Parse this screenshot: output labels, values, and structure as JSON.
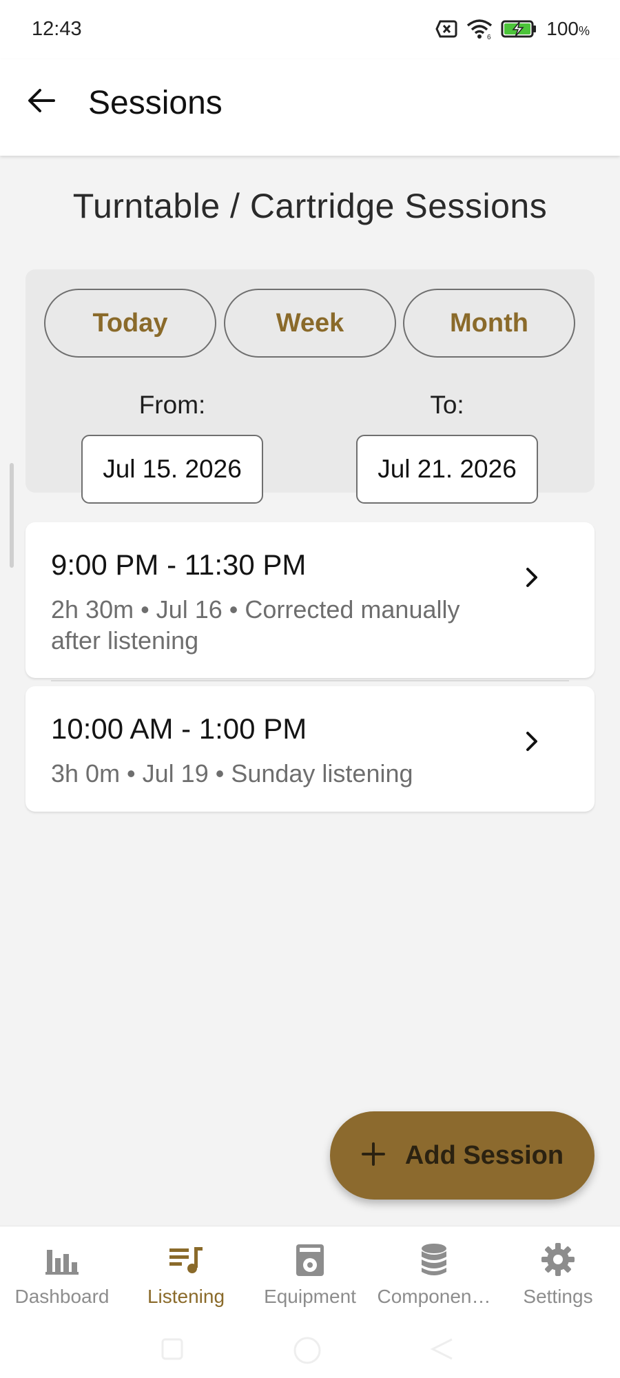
{
  "status_bar": {
    "time": "12:43",
    "battery": "100",
    "battery_unit": "%"
  },
  "app_bar": {
    "title": "Sessions",
    "back_icon": "arrow-back-icon"
  },
  "page": {
    "heading": "Turntable / Cartridge Sessions"
  },
  "filters": {
    "ranges": [
      {
        "label": "Today"
      },
      {
        "label": "Week"
      },
      {
        "label": "Month"
      }
    ],
    "from_label": "From:",
    "to_label": "To:",
    "from_value": "Jul 15. 2026",
    "to_value": "Jul 21. 2026"
  },
  "sessions": [
    {
      "time_range": "9:00 PM - 11:30 PM",
      "details": "2h 30m • Jul 16 • Corrected manually after listening"
    },
    {
      "time_range": "10:00 AM - 1:00 PM",
      "details": "3h 0m • Jul 19 • Sunday listening"
    }
  ],
  "fab": {
    "label": "Add Session",
    "icon": "plus-icon"
  },
  "bottom_nav": {
    "items": [
      {
        "label": "Dashboard",
        "icon": "bar-chart-icon"
      },
      {
        "label": "Listening",
        "icon": "music-list-icon",
        "active": true
      },
      {
        "label": "Equipment",
        "icon": "equipment-icon"
      },
      {
        "label": "Componen…",
        "icon": "database-icon"
      },
      {
        "label": "Settings",
        "icon": "gear-icon"
      }
    ]
  },
  "colors": {
    "accent": "#8c6a2e",
    "accent_text": "#8a6a2a",
    "background": "#f3f3f3",
    "inactive_nav": "#8d8d8d"
  }
}
